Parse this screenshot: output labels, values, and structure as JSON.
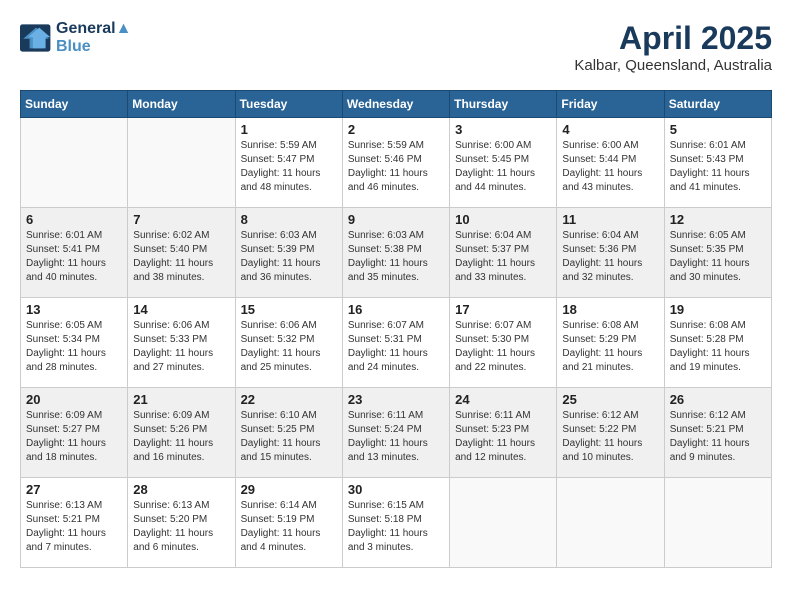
{
  "header": {
    "logo_line1": "General",
    "logo_line2": "Blue",
    "month": "April 2025",
    "location": "Kalbar, Queensland, Australia"
  },
  "days_of_week": [
    "Sunday",
    "Monday",
    "Tuesday",
    "Wednesday",
    "Thursday",
    "Friday",
    "Saturday"
  ],
  "weeks": [
    [
      {
        "day": "",
        "info": ""
      },
      {
        "day": "",
        "info": ""
      },
      {
        "day": "1",
        "info": "Sunrise: 5:59 AM\nSunset: 5:47 PM\nDaylight: 11 hours\nand 48 minutes."
      },
      {
        "day": "2",
        "info": "Sunrise: 5:59 AM\nSunset: 5:46 PM\nDaylight: 11 hours\nand 46 minutes."
      },
      {
        "day": "3",
        "info": "Sunrise: 6:00 AM\nSunset: 5:45 PM\nDaylight: 11 hours\nand 44 minutes."
      },
      {
        "day": "4",
        "info": "Sunrise: 6:00 AM\nSunset: 5:44 PM\nDaylight: 11 hours\nand 43 minutes."
      },
      {
        "day": "5",
        "info": "Sunrise: 6:01 AM\nSunset: 5:43 PM\nDaylight: 11 hours\nand 41 minutes."
      }
    ],
    [
      {
        "day": "6",
        "info": "Sunrise: 6:01 AM\nSunset: 5:41 PM\nDaylight: 11 hours\nand 40 minutes."
      },
      {
        "day": "7",
        "info": "Sunrise: 6:02 AM\nSunset: 5:40 PM\nDaylight: 11 hours\nand 38 minutes."
      },
      {
        "day": "8",
        "info": "Sunrise: 6:03 AM\nSunset: 5:39 PM\nDaylight: 11 hours\nand 36 minutes."
      },
      {
        "day": "9",
        "info": "Sunrise: 6:03 AM\nSunset: 5:38 PM\nDaylight: 11 hours\nand 35 minutes."
      },
      {
        "day": "10",
        "info": "Sunrise: 6:04 AM\nSunset: 5:37 PM\nDaylight: 11 hours\nand 33 minutes."
      },
      {
        "day": "11",
        "info": "Sunrise: 6:04 AM\nSunset: 5:36 PM\nDaylight: 11 hours\nand 32 minutes."
      },
      {
        "day": "12",
        "info": "Sunrise: 6:05 AM\nSunset: 5:35 PM\nDaylight: 11 hours\nand 30 minutes."
      }
    ],
    [
      {
        "day": "13",
        "info": "Sunrise: 6:05 AM\nSunset: 5:34 PM\nDaylight: 11 hours\nand 28 minutes."
      },
      {
        "day": "14",
        "info": "Sunrise: 6:06 AM\nSunset: 5:33 PM\nDaylight: 11 hours\nand 27 minutes."
      },
      {
        "day": "15",
        "info": "Sunrise: 6:06 AM\nSunset: 5:32 PM\nDaylight: 11 hours\nand 25 minutes."
      },
      {
        "day": "16",
        "info": "Sunrise: 6:07 AM\nSunset: 5:31 PM\nDaylight: 11 hours\nand 24 minutes."
      },
      {
        "day": "17",
        "info": "Sunrise: 6:07 AM\nSunset: 5:30 PM\nDaylight: 11 hours\nand 22 minutes."
      },
      {
        "day": "18",
        "info": "Sunrise: 6:08 AM\nSunset: 5:29 PM\nDaylight: 11 hours\nand 21 minutes."
      },
      {
        "day": "19",
        "info": "Sunrise: 6:08 AM\nSunset: 5:28 PM\nDaylight: 11 hours\nand 19 minutes."
      }
    ],
    [
      {
        "day": "20",
        "info": "Sunrise: 6:09 AM\nSunset: 5:27 PM\nDaylight: 11 hours\nand 18 minutes."
      },
      {
        "day": "21",
        "info": "Sunrise: 6:09 AM\nSunset: 5:26 PM\nDaylight: 11 hours\nand 16 minutes."
      },
      {
        "day": "22",
        "info": "Sunrise: 6:10 AM\nSunset: 5:25 PM\nDaylight: 11 hours\nand 15 minutes."
      },
      {
        "day": "23",
        "info": "Sunrise: 6:11 AM\nSunset: 5:24 PM\nDaylight: 11 hours\nand 13 minutes."
      },
      {
        "day": "24",
        "info": "Sunrise: 6:11 AM\nSunset: 5:23 PM\nDaylight: 11 hours\nand 12 minutes."
      },
      {
        "day": "25",
        "info": "Sunrise: 6:12 AM\nSunset: 5:22 PM\nDaylight: 11 hours\nand 10 minutes."
      },
      {
        "day": "26",
        "info": "Sunrise: 6:12 AM\nSunset: 5:21 PM\nDaylight: 11 hours\nand 9 minutes."
      }
    ],
    [
      {
        "day": "27",
        "info": "Sunrise: 6:13 AM\nSunset: 5:21 PM\nDaylight: 11 hours\nand 7 minutes."
      },
      {
        "day": "28",
        "info": "Sunrise: 6:13 AM\nSunset: 5:20 PM\nDaylight: 11 hours\nand 6 minutes."
      },
      {
        "day": "29",
        "info": "Sunrise: 6:14 AM\nSunset: 5:19 PM\nDaylight: 11 hours\nand 4 minutes."
      },
      {
        "day": "30",
        "info": "Sunrise: 6:15 AM\nSunset: 5:18 PM\nDaylight: 11 hours\nand 3 minutes."
      },
      {
        "day": "",
        "info": ""
      },
      {
        "day": "",
        "info": ""
      },
      {
        "day": "",
        "info": ""
      }
    ]
  ]
}
